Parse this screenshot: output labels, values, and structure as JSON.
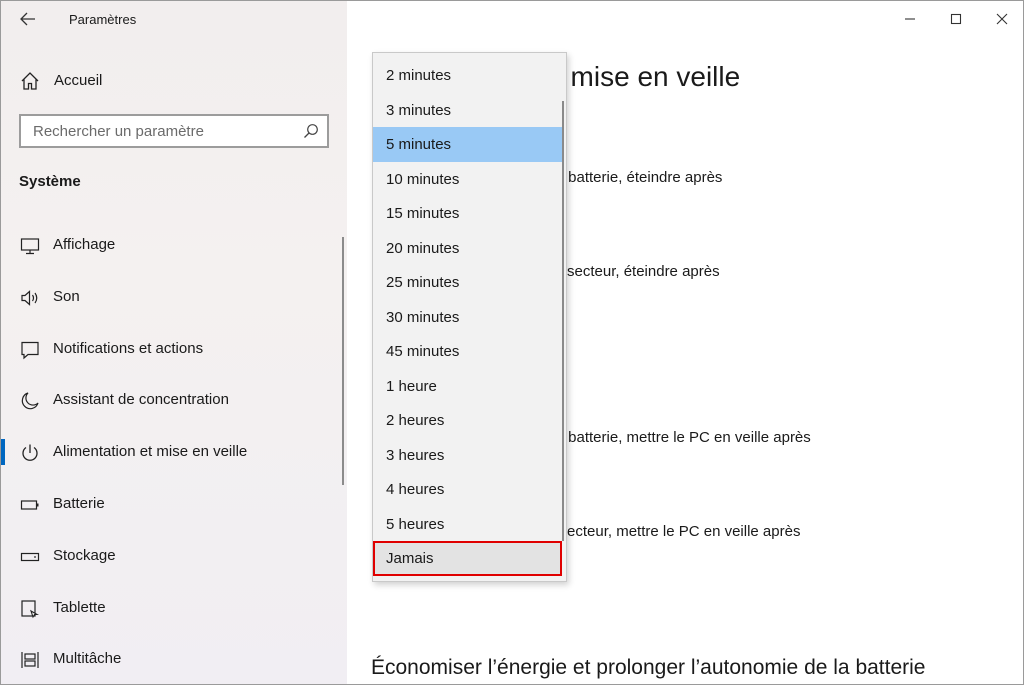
{
  "app": {
    "title": "Paramètres"
  },
  "sidebar": {
    "home_label": "Accueil",
    "search": {
      "placeholder": "Rechercher un paramètre"
    },
    "section_title": "Système",
    "items": [
      {
        "label": "Affichage",
        "icon": "monitor-icon",
        "active": false
      },
      {
        "label": "Son",
        "icon": "speaker-icon",
        "active": false
      },
      {
        "label": "Notifications et actions",
        "icon": "notification-icon",
        "active": false
      },
      {
        "label": "Assistant de concentration",
        "icon": "moon-icon",
        "active": false
      },
      {
        "label": "Alimentation et mise en veille",
        "icon": "power-icon",
        "active": true
      },
      {
        "label": "Batterie",
        "icon": "battery-icon",
        "active": false
      },
      {
        "label": "Stockage",
        "icon": "storage-icon",
        "active": false
      },
      {
        "label": "Tablette",
        "icon": "tablet-icon",
        "active": false
      },
      {
        "label": "Multitâche",
        "icon": "multitask-icon",
        "active": false
      }
    ]
  },
  "main": {
    "page_title_partial": "t mise en veille",
    "labels": [
      "r batterie, éteindre après",
      " secteur, éteindre après",
      "r batterie, mettre le PC en veille après",
      "ecteur, mettre le PC en veille après"
    ],
    "bottom_heading": "Économiser l’énergie et prolonger l’autonomie de la batterie"
  },
  "dropdown": {
    "options": [
      "2 minutes",
      "3 minutes",
      "5 minutes",
      "10 minutes",
      "15 minutes",
      "20 minutes",
      "25 minutes",
      "30 minutes",
      "45 minutes",
      "1 heure",
      "2 heures",
      "3 heures",
      "4 heures",
      "5 heures",
      "Jamais"
    ],
    "selected_option": "5 minutes",
    "highlighted_option": "Jamais"
  },
  "colors": {
    "accent": "#0067c0",
    "selected_bg": "#99c9f5",
    "highlight_outline": "#e00000"
  }
}
